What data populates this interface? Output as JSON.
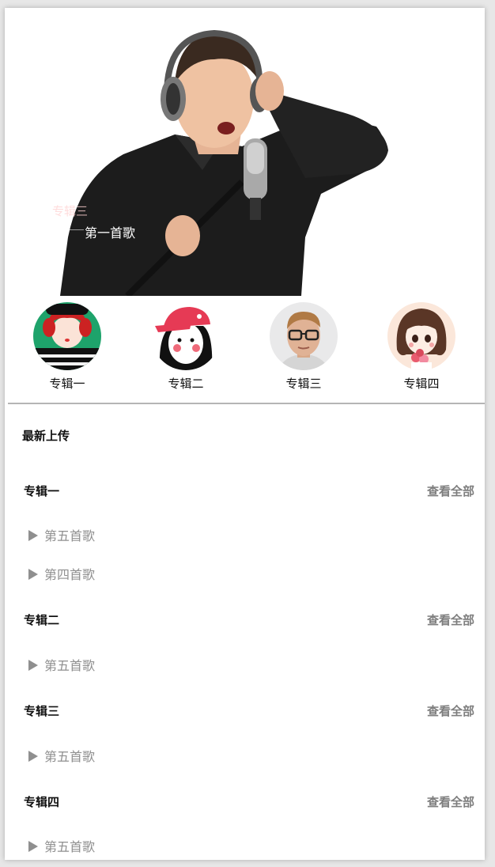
{
  "banner": {
    "prev_caption": "专辑三",
    "current_caption": "第一首歌"
  },
  "albums": [
    {
      "name": "专辑一",
      "icon": "cartoon-girl-green-avatar"
    },
    {
      "name": "专辑二",
      "icon": "cartoon-girl-red-cap-avatar"
    },
    {
      "name": "专辑三",
      "icon": "man-with-glasses-avatar"
    },
    {
      "name": "专辑四",
      "icon": "cartoon-girl-flowers-avatar"
    }
  ],
  "latest_label": "最新上传",
  "sections": [
    {
      "title": "专辑一",
      "more": "查看全部",
      "songs": [
        "第五首歌",
        "第四首歌"
      ]
    },
    {
      "title": "专辑二",
      "more": "查看全部",
      "songs": [
        "第五首歌"
      ]
    },
    {
      "title": "专辑三",
      "more": "查看全部",
      "songs": [
        "第五首歌"
      ]
    },
    {
      "title": "专辑四",
      "more": "查看全部",
      "songs": [
        "第五首歌"
      ]
    }
  ],
  "colors": {
    "song_text": "#8f8f8f",
    "more_text": "#7e7e7e",
    "divider": "#b5b5b5"
  }
}
